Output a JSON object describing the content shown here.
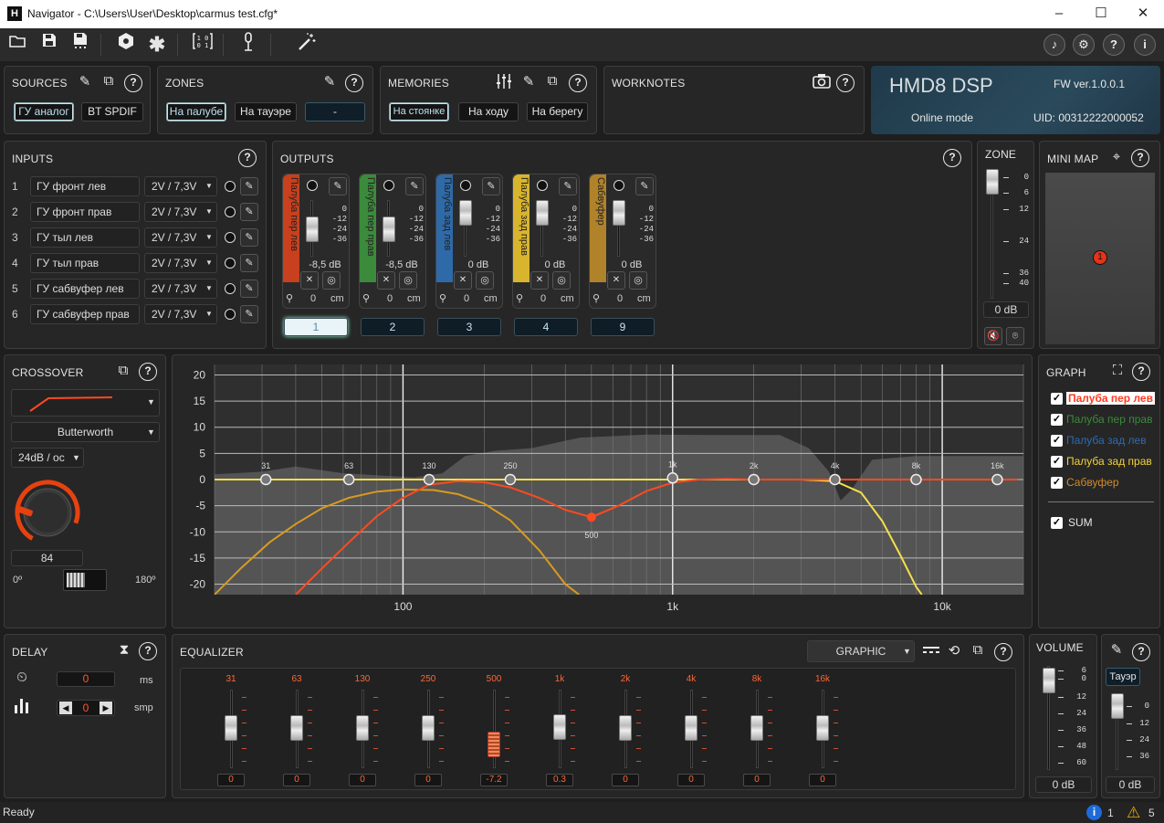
{
  "window": {
    "title": "Navigator - C:\\Users\\User\\Desktop\\carmus test.cfg*",
    "minimize": "–",
    "maximize": "☐",
    "close": "✕"
  },
  "sources": {
    "title": "SOURCES",
    "buttons": [
      "ГУ аналог",
      "BT SPDIF"
    ]
  },
  "zones": {
    "title": "ZONES",
    "buttons": [
      "На палубе",
      "На тауэре",
      "-"
    ]
  },
  "memories": {
    "title": "MEMORIES",
    "buttons": [
      "На стоянке",
      "На ходу",
      "На берегу"
    ]
  },
  "worknotes": {
    "title": "WORKNOTES"
  },
  "device": {
    "name": "HMD8 DSP",
    "fw": "FW ver.1.0.0.1",
    "mode": "Online mode",
    "uid": "UID: 00312222000052"
  },
  "inputs": {
    "title": "INPUTS",
    "rows": [
      {
        "n": "1",
        "name": "ГУ фронт лев",
        "level": "2V / 7,3V"
      },
      {
        "n": "2",
        "name": "ГУ фронт прав",
        "level": "2V / 7,3V"
      },
      {
        "n": "3",
        "name": "ГУ тыл лев",
        "level": "2V / 7,3V"
      },
      {
        "n": "4",
        "name": "ГУ тыл прав",
        "level": "2V / 7,3V"
      },
      {
        "n": "5",
        "name": "ГУ сабвуфер лев",
        "level": "2V / 7,3V"
      },
      {
        "n": "6",
        "name": "ГУ сабвуфер прав",
        "level": "2V / 7,3V"
      }
    ]
  },
  "outputs": {
    "title": "OUTPUTS",
    "ticks": [
      "0",
      "-12",
      "-24",
      "-36"
    ],
    "unit": "cm",
    "channels": [
      {
        "name": "Палуба пер лев",
        "color": "#c8401e",
        "gain": "-8,5 dB",
        "distance": "0",
        "channel": "1",
        "fader": 0.2
      },
      {
        "name": "Палуба пер прав",
        "color": "#3c8a3c",
        "gain": "-8,5 dB",
        "distance": "0",
        "channel": "2",
        "fader": 0.2
      },
      {
        "name": "Палуба зад лев",
        "color": "#2f6aa8",
        "gain": "0 dB",
        "distance": "0",
        "channel": "3",
        "fader": 0
      },
      {
        "name": "Палуба зад прав",
        "color": "#d9b52e",
        "gain": "0 dB",
        "distance": "0",
        "channel": "4",
        "fader": 0
      },
      {
        "name": "Сабвуфер",
        "color": "#b0822a",
        "gain": "0 dB",
        "distance": "0",
        "channel": "9",
        "fader": 0
      }
    ]
  },
  "zone": {
    "title": "ZONE",
    "ticks": [
      "0",
      "6",
      "12",
      "24",
      "36",
      "40"
    ],
    "value": "0 dB"
  },
  "minimap": {
    "title": "MINI MAP",
    "marker": "1"
  },
  "crossover": {
    "title": "CROSSOVER",
    "type": "Butterworth",
    "slope": "24dB / oc",
    "knob_value": "84",
    "phase_min": "0º",
    "phase_max": "180º"
  },
  "graph": {
    "title": "GRAPH",
    "legend": [
      {
        "label": "Палуба пер лев",
        "color": "#ff3b1f",
        "checked": true,
        "highlight": true
      },
      {
        "label": "Палуба пер прав",
        "color": "#3b8a3b",
        "checked": true
      },
      {
        "label": "Палуба зад лев",
        "color": "#2f6bb0",
        "checked": true
      },
      {
        "label": "Палуба зад прав",
        "color": "#f2d23a",
        "checked": true
      },
      {
        "label": "Сабвуфер",
        "color": "#d08a2a",
        "checked": true
      }
    ],
    "sum_label": "SUM"
  },
  "chart_data": {
    "type": "line",
    "xscale": "log",
    "xlim": [
      20,
      20000
    ],
    "ylim": [
      -22,
      22
    ],
    "yticks": [
      20,
      15,
      10,
      5,
      0,
      -5,
      -10,
      -15,
      -20
    ],
    "xtick_labels": [
      "100",
      "1k",
      "10k"
    ],
    "xtick_values": [
      100,
      1000,
      10000
    ],
    "grid": true,
    "points": [
      {
        "f": 31,
        "label": "31",
        "g": 0
      },
      {
        "f": 63,
        "label": "63",
        "g": 0
      },
      {
        "f": 125,
        "label": "130",
        "g": 0
      },
      {
        "f": 250,
        "label": "250",
        "g": 0
      },
      {
        "f": 500,
        "label": "500",
        "g": -7.2
      },
      {
        "f": 1000,
        "label": "1k",
        "g": 0.3
      },
      {
        "f": 2000,
        "label": "2k",
        "g": 0
      },
      {
        "f": 4000,
        "label": "4k",
        "g": 0
      },
      {
        "f": 8000,
        "label": "8k",
        "g": 0
      },
      {
        "f": 16000,
        "label": "16k",
        "g": 0
      }
    ],
    "series": [
      {
        "color": "#ff4a1f",
        "x": [
          40,
          50,
          63,
          80,
          100,
          125,
          160,
          200,
          250,
          320,
          400,
          500,
          630,
          800,
          1000,
          1250,
          1600,
          2000,
          3000,
          4000,
          6000,
          10000,
          16000,
          19000
        ],
        "y": [
          -22,
          -17,
          -12,
          -7,
          -3.5,
          -1,
          -0.3,
          -0.5,
          -1.5,
          -3.5,
          -5.8,
          -7.2,
          -5,
          -2.2,
          -0.6,
          0,
          0.1,
          0,
          0,
          0,
          0,
          0,
          0,
          0
        ]
      },
      {
        "color": "#d89a20",
        "x": [
          20,
          25,
          32,
          40,
          50,
          63,
          80,
          100,
          130,
          160,
          200,
          250,
          320,
          400,
          450
        ],
        "y": [
          -22,
          -17,
          -12,
          -8.5,
          -5.5,
          -3.5,
          -2.3,
          -1.9,
          -2,
          -2.8,
          -4.6,
          -7.8,
          -13.5,
          -20,
          -22
        ]
      },
      {
        "color": "#f4e04a",
        "x": [
          20,
          1000,
          3000,
          4000,
          5000,
          6000,
          7000,
          8000,
          8400
        ],
        "y": [
          0,
          0,
          0,
          -0.3,
          -2.5,
          -8,
          -14.5,
          -20.5,
          -22
        ]
      }
    ]
  },
  "delay": {
    "title": "DELAY",
    "ms": "0",
    "ms_unit": "ms",
    "smp": "0",
    "smp_unit": "smp"
  },
  "equalizer": {
    "title": "EQUALIZER",
    "mode": "GRAPHIC",
    "bands": [
      {
        "f": "31",
        "v": "0",
        "p": 0
      },
      {
        "f": "63",
        "v": "0",
        "p": 0
      },
      {
        "f": "130",
        "v": "0",
        "p": 0
      },
      {
        "f": "250",
        "v": "0",
        "p": 0
      },
      {
        "f": "500",
        "v": "-7.2",
        "p": -0.45
      },
      {
        "f": "1k",
        "v": "0.3",
        "p": 0.02
      },
      {
        "f": "2k",
        "v": "0",
        "p": 0
      },
      {
        "f": "4k",
        "v": "0",
        "p": 0
      },
      {
        "f": "8k",
        "v": "0",
        "p": 0
      },
      {
        "f": "16k",
        "v": "0",
        "p": 0
      }
    ]
  },
  "volume": {
    "title": "VOLUME",
    "ticks": [
      "6",
      "0",
      "12",
      "24",
      "36",
      "48",
      "60"
    ],
    "value": "0 dB"
  },
  "tower": {
    "label": "Тауэр",
    "ticks": [
      "0",
      "12",
      "24",
      "36"
    ],
    "value": "0 dB"
  },
  "status": {
    "text": "Ready",
    "info_count": "1",
    "warn_count": "5"
  }
}
